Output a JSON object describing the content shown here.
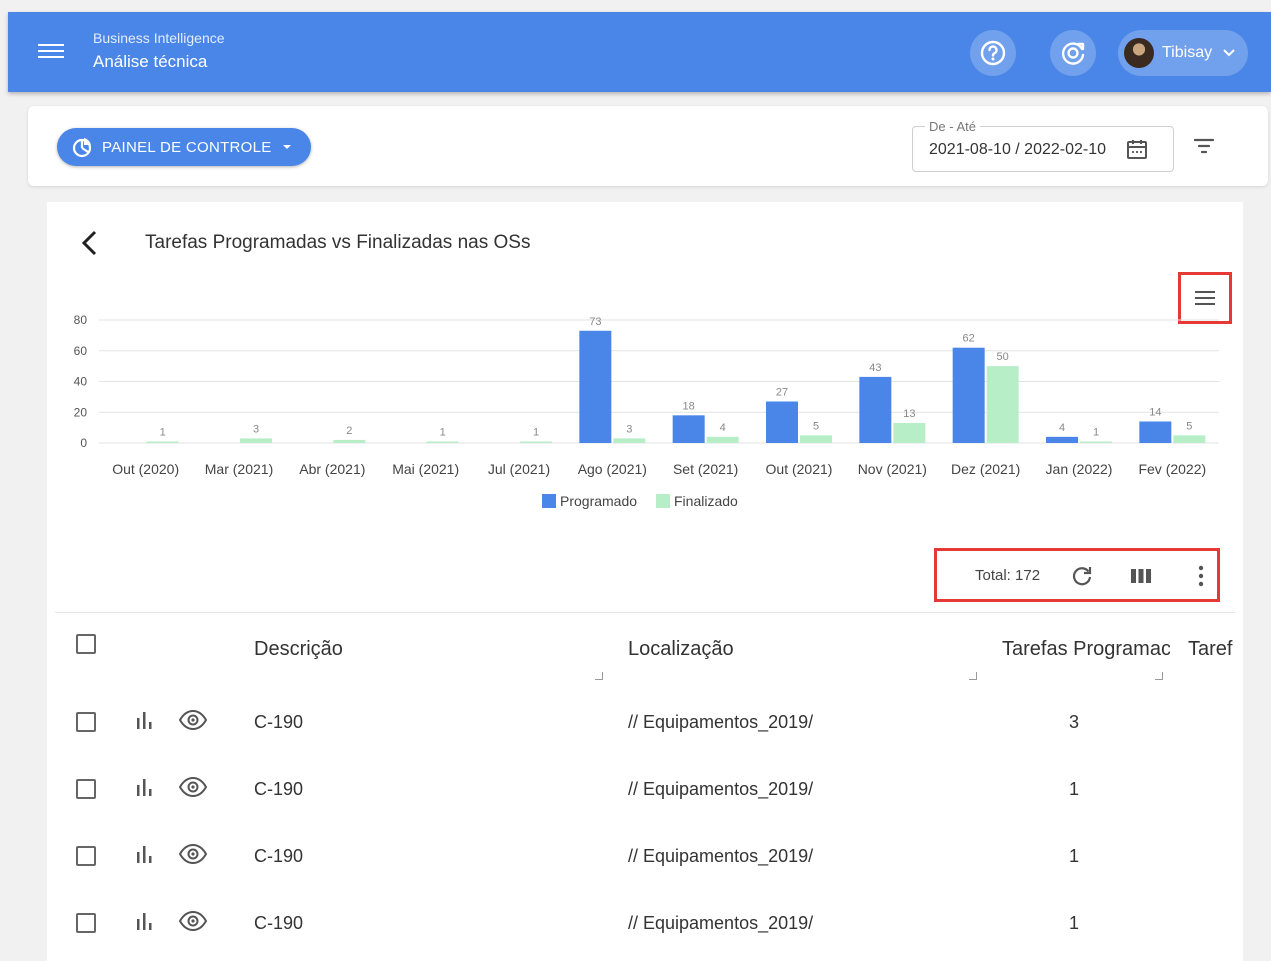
{
  "header": {
    "app_name": "Business Intelligence",
    "page_title": "Análise técnica",
    "user_name": "Tibisay"
  },
  "toolbar": {
    "dashboard_label": "PAINEL DE CONTROLE",
    "date_label": "De - Até",
    "date_value": "2021-08-10 / 2022-02-10"
  },
  "chart_section": {
    "title": "Tarefas Programadas vs Finalizadas nas OSs"
  },
  "chart_data": {
    "type": "bar",
    "title": "Tarefas Programadas vs Finalizadas nas OSs",
    "categories": [
      "Out (2020)",
      "Mar (2021)",
      "Abr (2021)",
      "Mai (2021)",
      "Jul (2021)",
      "Ago (2021)",
      "Set (2021)",
      "Out (2021)",
      "Nov (2021)",
      "Dez (2021)",
      "Jan (2022)",
      "Fev (2022)"
    ],
    "series": [
      {
        "name": "Programado",
        "color": "#4a86e8",
        "values": [
          null,
          null,
          null,
          null,
          null,
          73,
          18,
          27,
          43,
          62,
          4,
          14
        ]
      },
      {
        "name": "Finalizado",
        "color": "#b7eec8",
        "values": [
          1,
          3,
          2,
          1,
          1,
          3,
          4,
          5,
          13,
          50,
          1,
          5
        ]
      }
    ],
    "yticks": [
      0,
      20,
      40,
      60,
      80
    ],
    "ylim": [
      0,
      80
    ],
    "legend": "bottom",
    "grid": true
  },
  "table": {
    "total_label": "Total: 172",
    "columns": [
      "Descrição",
      "Localização",
      "Tarefas Programac",
      "Taref"
    ],
    "rows": [
      {
        "descricao": "C-190",
        "localizacao": "// Equipamentos_2019/",
        "programadas": "3"
      },
      {
        "descricao": "C-190",
        "localizacao": "// Equipamentos_2019/",
        "programadas": "1"
      },
      {
        "descricao": "C-190",
        "localizacao": "// Equipamentos_2019/",
        "programadas": "1"
      },
      {
        "descricao": "C-190",
        "localizacao": "// Equipamentos_2019/",
        "programadas": "1"
      }
    ]
  },
  "colors": {
    "primary": "#4a86e8",
    "highlight": "#e53935",
    "finalizado": "#b7eec8"
  },
  "icons": [
    "menu-icon",
    "help-icon",
    "refresh-target-icon",
    "chevron-down-icon",
    "dashboard-icon",
    "calendar-icon",
    "filter-icon",
    "back-icon",
    "chart-menu-icon",
    "refresh-icon",
    "columns-icon",
    "more-vert-icon",
    "bar-chart-icon",
    "eye-icon"
  ]
}
